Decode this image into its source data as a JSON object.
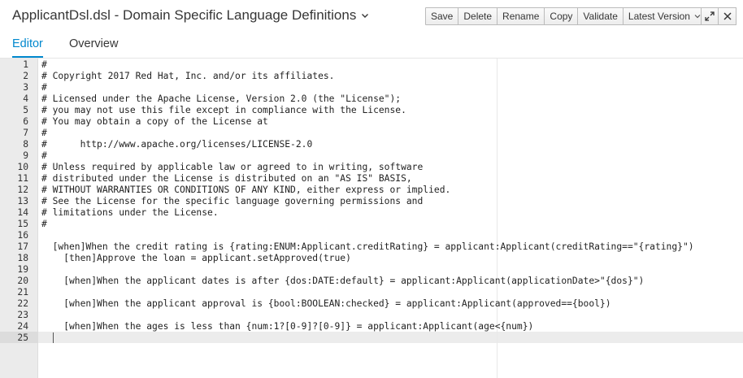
{
  "header": {
    "title": "ApplicantDsl.dsl - Domain Specific Language Definitions",
    "title_menu_icon": "chevron-down-icon"
  },
  "toolbar": {
    "save_label": "Save",
    "delete_label": "Delete",
    "rename_label": "Rename",
    "copy_label": "Copy",
    "validate_label": "Validate",
    "version_label": "Latest Version",
    "expand_icon": "expand-icon",
    "close_icon": "close-icon"
  },
  "tabs": [
    {
      "label": "Editor",
      "active": true
    },
    {
      "label": "Overview",
      "active": false
    }
  ],
  "colors": {
    "accent": "#0088ce",
    "gutter": "#ebebeb",
    "text": "#363636"
  },
  "editor": {
    "cursor_line": 25,
    "lines": [
      {
        "num": "1",
        "text": "#"
      },
      {
        "num": "2",
        "text": "# Copyright 2017 Red Hat, Inc. and/or its affiliates."
      },
      {
        "num": "3",
        "text": "#"
      },
      {
        "num": "4",
        "text": "# Licensed under the Apache License, Version 2.0 (the \"License\");"
      },
      {
        "num": "5",
        "text": "# you may not use this file except in compliance with the License."
      },
      {
        "num": "6",
        "text": "# You may obtain a copy of the License at"
      },
      {
        "num": "7",
        "text": "#"
      },
      {
        "num": "8",
        "text": "#      http://www.apache.org/licenses/LICENSE-2.0"
      },
      {
        "num": "9",
        "text": "#"
      },
      {
        "num": "10",
        "text": "# Unless required by applicable law or agreed to in writing, software"
      },
      {
        "num": "11",
        "text": "# distributed under the License is distributed on an \"AS IS\" BASIS,"
      },
      {
        "num": "12",
        "text": "# WITHOUT WARRANTIES OR CONDITIONS OF ANY KIND, either express or implied."
      },
      {
        "num": "13",
        "text": "# See the License for the specific language governing permissions and"
      },
      {
        "num": "14",
        "text": "# limitations under the License."
      },
      {
        "num": "15",
        "text": "#"
      },
      {
        "num": "16",
        "text": ""
      },
      {
        "num": "17",
        "text": "  [when]When the credit rating is {rating:ENUM:Applicant.creditRating} = applicant:Applicant(creditRating==\"{rating}\")"
      },
      {
        "num": "18",
        "text": "    [then]Approve the loan = applicant.setApproved(true)"
      },
      {
        "num": "19",
        "text": ""
      },
      {
        "num": "20",
        "text": "    [when]When the applicant dates is after {dos:DATE:default} = applicant:Applicant(applicationDate>\"{dos}\")"
      },
      {
        "num": "21",
        "text": ""
      },
      {
        "num": "22",
        "text": "    [when]When the applicant approval is {bool:BOOLEAN:checked} = applicant:Applicant(approved=={bool})"
      },
      {
        "num": "23",
        "text": ""
      },
      {
        "num": "24",
        "text": "    [when]When the ages is less than {num:1?[0-9]?[0-9]} = applicant:Applicant(age<{num})"
      },
      {
        "num": "25",
        "text": ""
      }
    ]
  }
}
